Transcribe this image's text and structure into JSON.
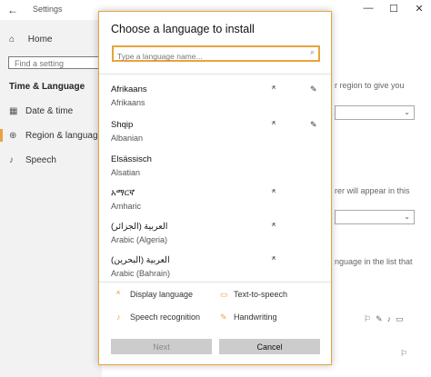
{
  "window": {
    "title": "Settings",
    "back_glyph": "←",
    "minimize_glyph": "—",
    "maximize_glyph": "☐",
    "close_glyph": "✕"
  },
  "sidebar": {
    "home": "Home",
    "search_placeholder": "Find a setting",
    "section": "Time & Language",
    "items": [
      {
        "label": "Date & time",
        "icon": "calendar-icon",
        "glyph": "▦"
      },
      {
        "label": "Region & language",
        "icon": "globe-icon",
        "glyph": "⊕"
      },
      {
        "label": "Speech",
        "icon": "microphone-icon",
        "glyph": "♪"
      }
    ],
    "accent": "#e8a33e"
  },
  "background": {
    "region_text": "r region to give you",
    "display_text": "rer will appear in this",
    "list_text": "nguage in the list that"
  },
  "dialog": {
    "title": "Choose a language to install",
    "search_placeholder": "Type a language name...",
    "languages": [
      {
        "name": "Afrikaans",
        "sub": "Afrikaans",
        "display_language": true,
        "handwriting": true
      },
      {
        "name": "Shqip",
        "sub": "Albanian",
        "display_language": true,
        "handwriting": true
      },
      {
        "name": "Elsässisch",
        "sub": "Alsatian",
        "display_language": false,
        "handwriting": false
      },
      {
        "name": "አማርኛ",
        "sub": "Amharic",
        "display_language": true,
        "handwriting": false
      },
      {
        "name": "العربية (الجزائر)",
        "sub": "Arabic (Algeria)",
        "display_language": true,
        "handwriting": false
      },
      {
        "name": "العربية (البحرين)",
        "sub": "Arabic (Bahrain)",
        "display_language": true,
        "handwriting": false
      }
    ],
    "legend": {
      "display_language": "Display language",
      "text_to_speech": "Text-to-speech",
      "speech_recognition": "Speech recognition",
      "handwriting": "Handwriting"
    },
    "next_label": "Next",
    "cancel_label": "Cancel"
  }
}
